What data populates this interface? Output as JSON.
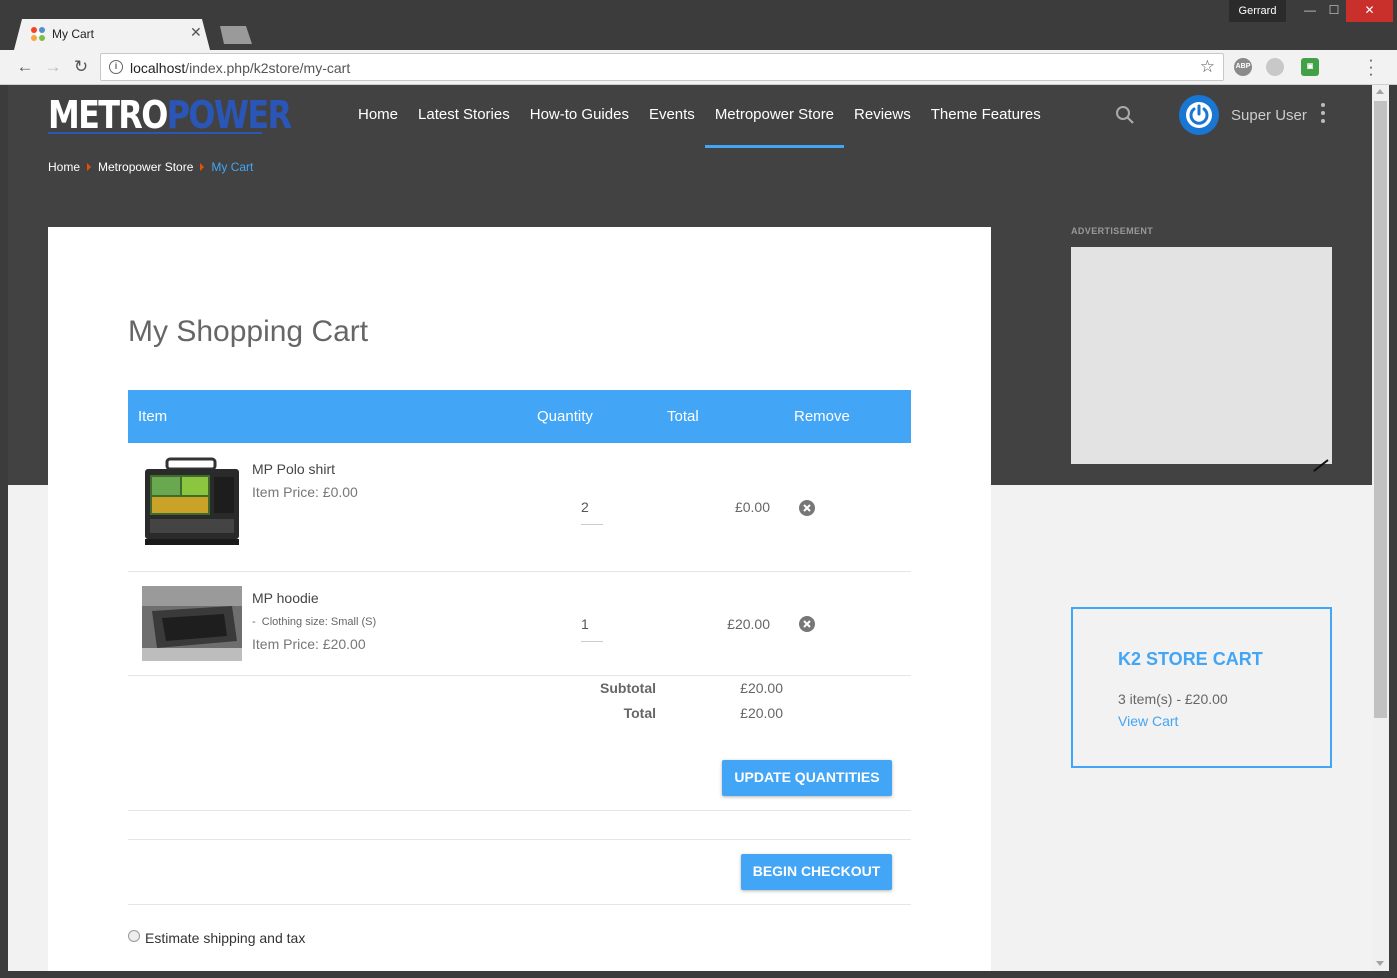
{
  "browser": {
    "tab_title": "My Cart",
    "user_name": "Gerrard",
    "url_host": "localhost",
    "url_path": "/index.php/k2store/my-cart",
    "extensions": [
      "adblock-icon",
      "extension-icon",
      "printer-extension-icon"
    ]
  },
  "site": {
    "logo_part1": "METRO",
    "logo_part2": "POWER",
    "nav": [
      "Home",
      "Latest Stories",
      "How-to Guides",
      "Events",
      "Metropower Store",
      "Reviews",
      "Theme Features"
    ],
    "active_nav": "Metropower Store",
    "user_label": "Super User"
  },
  "breadcrumb": {
    "items": [
      "Home",
      "Metropower Store"
    ],
    "current": "My Cart"
  },
  "cart": {
    "title": "My Shopping Cart",
    "headers": {
      "item": "Item",
      "quantity": "Quantity",
      "total": "Total",
      "remove": "Remove"
    },
    "items": [
      {
        "name": "MP Polo shirt",
        "price_label": "Item Price: £0.00",
        "quantity": "2",
        "total": "£0.00",
        "option": ""
      },
      {
        "name": "MP hoodie",
        "option": "Clothing size: Small (S)",
        "option_prefix": "-",
        "price_label": "Item Price: £20.00",
        "quantity": "1",
        "total": "£20.00"
      }
    ],
    "subtotal_label": "Subtotal",
    "subtotal_value": "£20.00",
    "total_label": "Total",
    "total_value": "£20.00",
    "update_button": "UPDATE QUANTITIES",
    "checkout_button": "BEGIN CHECKOUT",
    "estimate_label": "Estimate shipping and tax"
  },
  "sidebar": {
    "ad_label": "ADVERTISEMENT",
    "k2_title": "K2 STORE CART",
    "k2_summary": "3 item(s) - £20.00",
    "k2_link": "View Cart"
  },
  "colors": {
    "accent": "#42a5f5",
    "header_bg": "#424242",
    "page_bg": "#f2f2f2",
    "orange_sep": "#e65100"
  }
}
